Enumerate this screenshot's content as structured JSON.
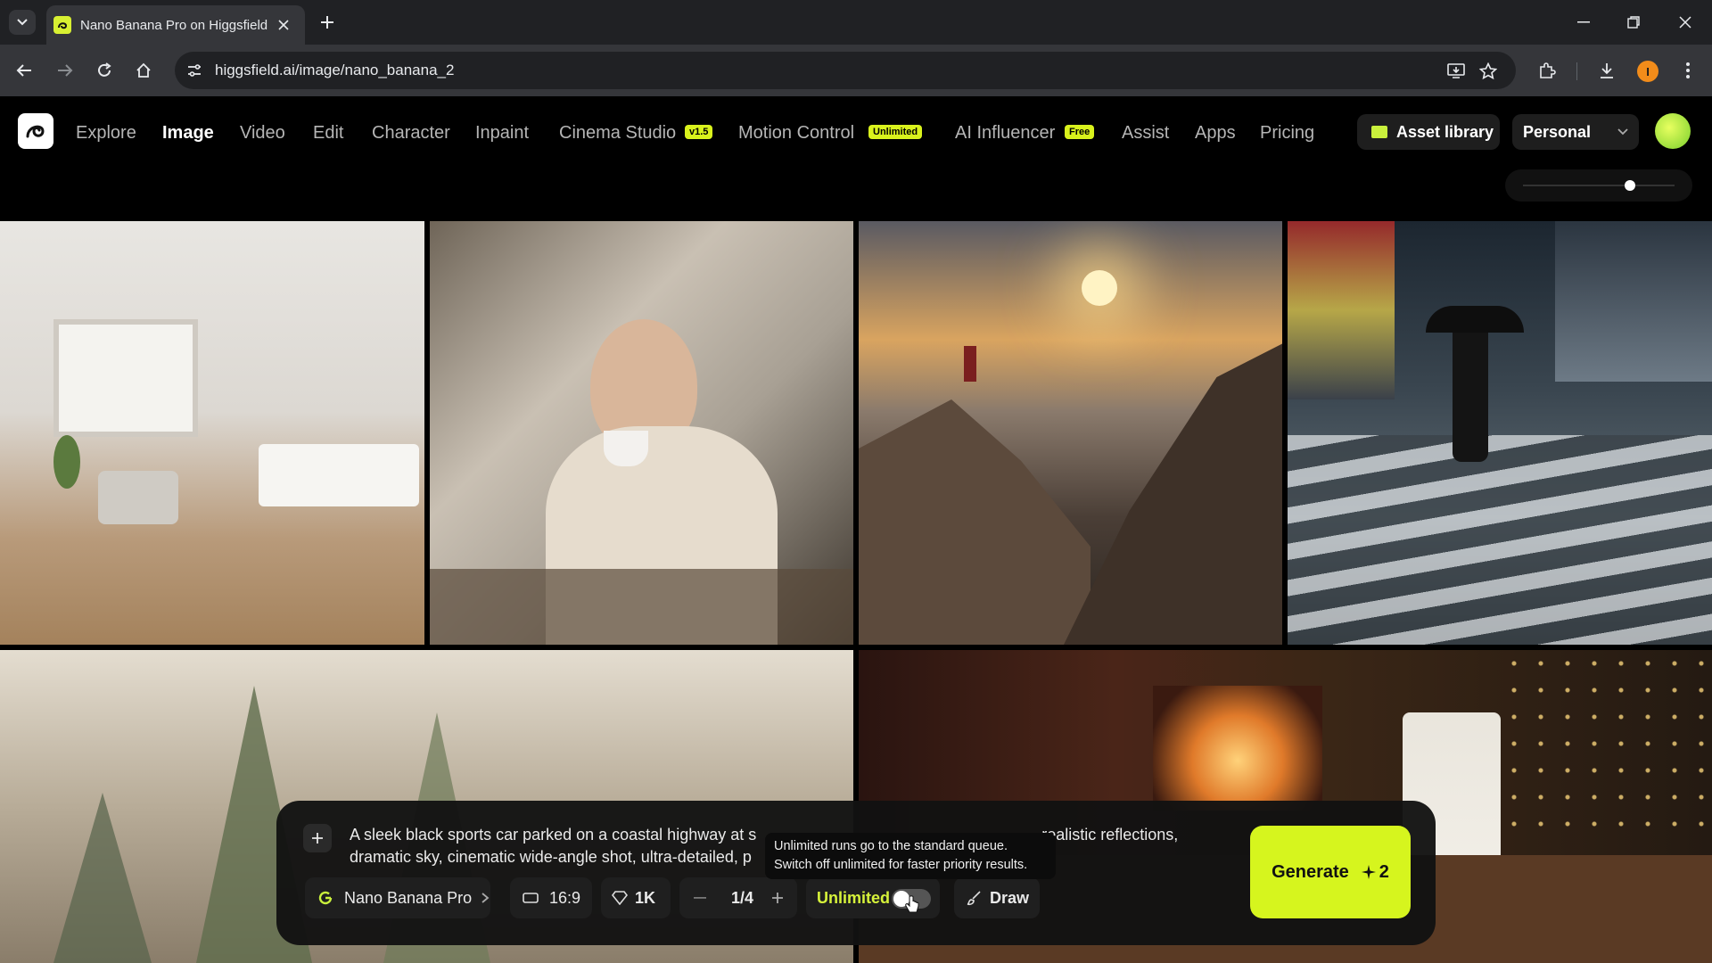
{
  "browser": {
    "tab_title": "Nano Banana Pro on Higgsfield",
    "url": "higgsfield.ai/image/nano_banana_2",
    "profile_initial": "I"
  },
  "nav": {
    "items": [
      {
        "label": "Explore"
      },
      {
        "label": "Image"
      },
      {
        "label": "Video"
      },
      {
        "label": "Edit"
      },
      {
        "label": "Character"
      },
      {
        "label": "Inpaint"
      },
      {
        "label": "Cinema Studio",
        "badge": "v1.5"
      },
      {
        "label": "Motion Control",
        "badge": "Unlimited"
      },
      {
        "label": "AI Influencer",
        "badge": "Free"
      },
      {
        "label": "Assist"
      },
      {
        "label": "Apps"
      },
      {
        "label": "Pricing"
      }
    ],
    "active": "Image",
    "asset_library": "Asset library",
    "workspace": "Personal"
  },
  "prompt": {
    "text_line1": "A sleek black sports car parked on a coastal highway at s",
    "text_line1_tail": "realistic reflections,",
    "text_line2": "dramatic sky, cinematic wide-angle shot, ultra-detailed, p"
  },
  "controls": {
    "model": "Nano Banana Pro",
    "aspect_ratio": "16:9",
    "resolution": "1K",
    "count": "1/4",
    "unlimited_label": "Unlimited",
    "unlimited_on": false,
    "draw_label": "Draw",
    "generate_label": "Generate",
    "generate_cost": "2"
  },
  "tooltip": {
    "line1": "Unlimited runs go to the standard queue.",
    "line2": "Switch off unlimited for faster priority results."
  },
  "colors": {
    "accent": "#d6f51e",
    "background": "#000000",
    "panel": "#121212"
  }
}
